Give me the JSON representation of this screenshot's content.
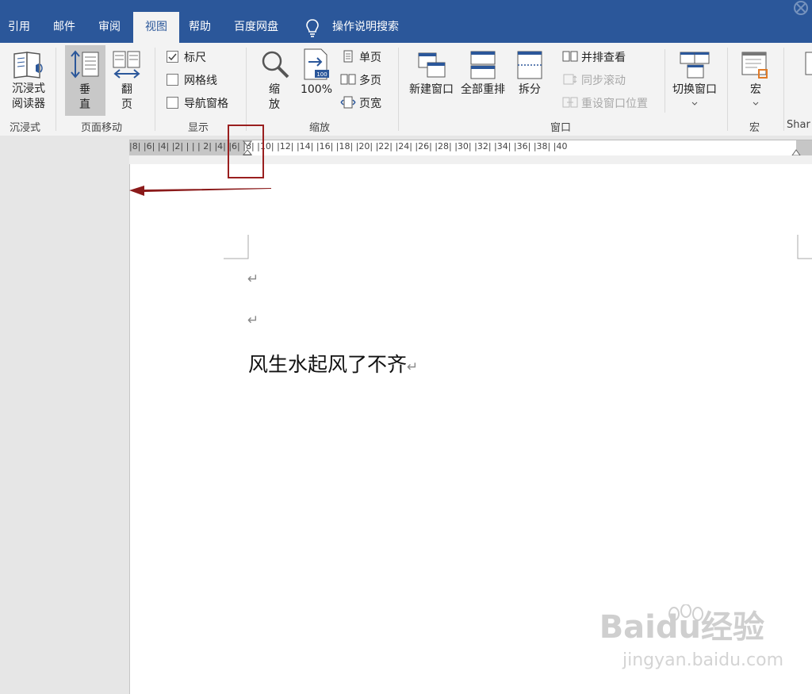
{
  "tabs": [
    {
      "label": "引用",
      "active": false
    },
    {
      "label": "邮件",
      "active": false
    },
    {
      "label": "审阅",
      "active": false
    },
    {
      "label": "视图",
      "active": true
    },
    {
      "label": "帮助",
      "active": false
    },
    {
      "label": "百度网盘",
      "active": false
    }
  ],
  "tell_me": "操作说明搜索",
  "ribbon": {
    "immersive": {
      "button": "沉浸式\n阅读器",
      "group": "沉浸式"
    },
    "page_move": {
      "vertical": "垂\n直",
      "flip": "翻\n页",
      "group": "页面移动"
    },
    "show": {
      "ruler": "标尺",
      "gridlines": "网格线",
      "nav_pane": "导航窗格",
      "group": "显示",
      "ruler_checked": true,
      "gridlines_checked": false,
      "nav_checked": false
    },
    "zoom": {
      "zoom": "缩\n放",
      "hundred": "100%",
      "one_page": "单页",
      "multi_page": "多页",
      "page_width": "页宽",
      "group": "缩放"
    },
    "window": {
      "new_window": "新建窗口",
      "arrange_all": "全部重排",
      "split": "拆分",
      "side_by_side": "并排查看",
      "sync_scroll": "同步滚动",
      "reset_pos": "重设窗口位置",
      "switch": "切换窗口",
      "group": "窗口"
    },
    "macros": {
      "button": "宏",
      "group": "宏"
    },
    "share_partial": "Shar"
  },
  "ruler_labels": "|8| |6| |4| |2| |  |  | 2| |4| |6| |8| |10| |12| |14| |16| |18| |20| |22| |24| |26| |28| |30| |32| |34| |36| |38| |40",
  "document": {
    "text": "风生水起风了不齐",
    "para_mark": "↵"
  },
  "watermark": {
    "brand": "Baidu经验",
    "url": "jingyan.baidu.com"
  },
  "colors": {
    "accent": "#2b579a",
    "annotation": "#9a1f1f"
  }
}
